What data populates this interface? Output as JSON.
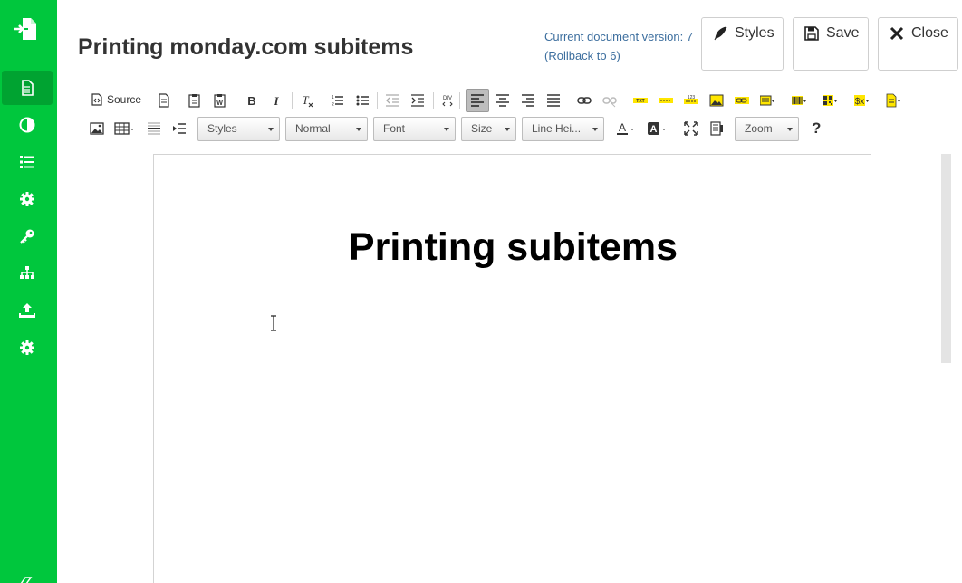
{
  "sidebar": {
    "items": [
      {
        "icon": "document-icon",
        "active": true
      },
      {
        "icon": "contrast-icon",
        "active": false
      },
      {
        "icon": "list-icon",
        "active": false
      },
      {
        "icon": "gear-icon",
        "active": false
      },
      {
        "icon": "key-icon",
        "active": false
      },
      {
        "icon": "sitemap-icon",
        "active": false
      },
      {
        "icon": "upload-icon",
        "active": false
      },
      {
        "icon": "settings-icon",
        "active": false
      }
    ],
    "accent": "#00c73d",
    "active_bg": "#00a331"
  },
  "header": {
    "title": "Printing monday.com subitems",
    "version_text": "Current document version: 7",
    "rollback_text": "(Rollback to 6)",
    "buttons": {
      "styles": "Styles",
      "save": "Save",
      "close": "Close"
    }
  },
  "toolbar": {
    "source_label": "Source",
    "combos": {
      "styles": "Styles",
      "format": "Normal",
      "font": "Font",
      "size": "Size",
      "line_height": "Line Hei...",
      "zoom": "Zoom"
    },
    "help": "?"
  },
  "document": {
    "heading": "Printing subitems"
  }
}
